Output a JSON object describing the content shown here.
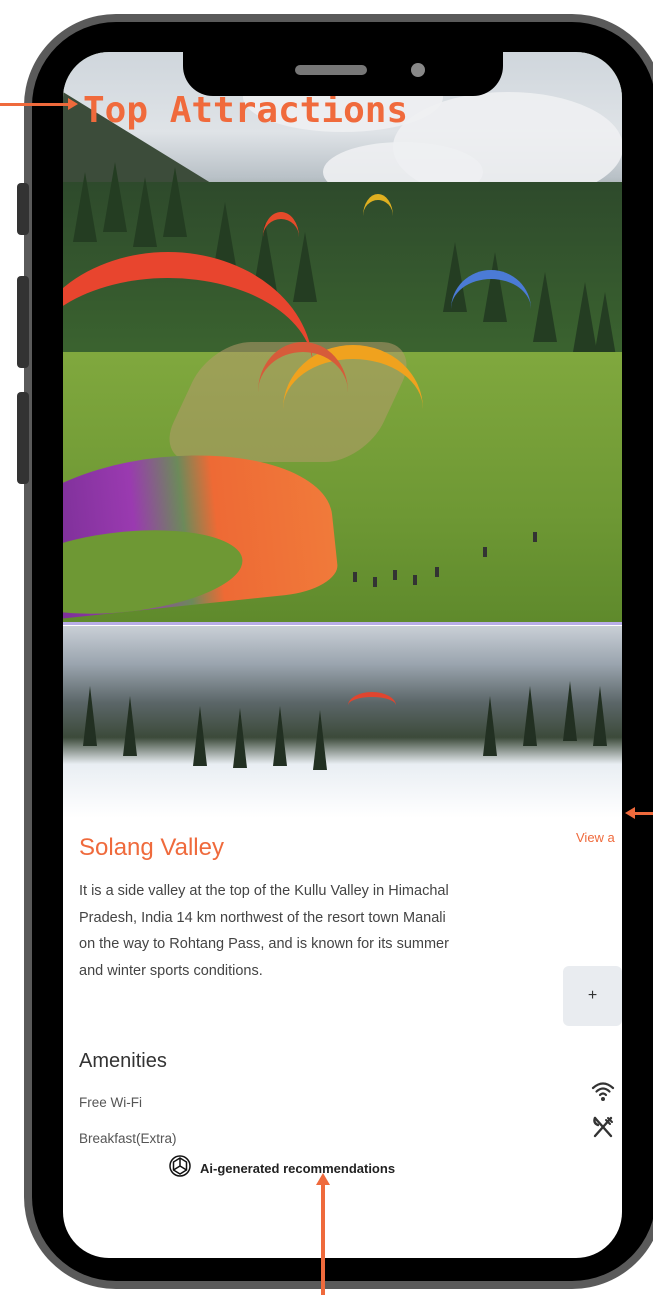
{
  "header": {
    "title": "Top Attractions"
  },
  "attraction": {
    "name": "Solang Valley",
    "view_all_label": "View a",
    "description": "It is a side valley at the top of the Kullu Valley in Himachal Pradesh, India 14 km northwest of the resort town Manali on the way to Rohtang Pass, and is known for its summer and winter sports conditions.",
    "add_label": "+"
  },
  "amenities": {
    "title": "Amenities",
    "items": [
      {
        "label": "Free Wi-Fi",
        "icon": "wifi-icon"
      },
      {
        "label": "Breakfast(Extra)",
        "icon": "utensils-icon"
      }
    ]
  },
  "footer": {
    "ai_label": "Ai-generated recommendations",
    "ai_icon": "openai-icon"
  },
  "colors": {
    "accent": "#ef6a3c",
    "frame": "#5a5a5a",
    "button_bg": "#e9ecf0"
  }
}
